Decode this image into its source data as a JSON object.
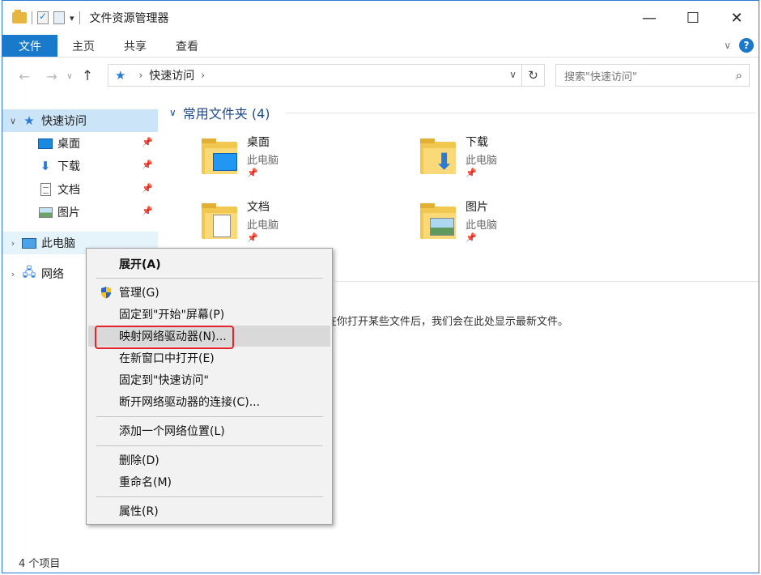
{
  "window": {
    "title": "文件资源管理器",
    "controls": {
      "minimize": "—",
      "maximize": "☐",
      "close": "✕"
    }
  },
  "ribbon": {
    "tabs": [
      "文件",
      "主页",
      "共享",
      "查看"
    ],
    "collapse": "∨",
    "help": "?"
  },
  "address": {
    "back": "←",
    "forward": "→",
    "recent": "∨",
    "up": "↑",
    "path": "快速访问",
    "refresh": "↻",
    "search_placeholder": "搜索\"快速访问\""
  },
  "nav": {
    "quick_access": "快速访问",
    "items": [
      {
        "label": "桌面",
        "icon": "desktop-icon"
      },
      {
        "label": "下载",
        "icon": "download-icon"
      },
      {
        "label": "文档",
        "icon": "documents-icon"
      },
      {
        "label": "图片",
        "icon": "pictures-icon"
      }
    ],
    "this_pc": "此电脑",
    "network": "网络"
  },
  "content": {
    "group_header": "常用文件夹 (4)",
    "folders": [
      {
        "name": "桌面",
        "location": "此电脑"
      },
      {
        "name": "下载",
        "location": "此电脑"
      },
      {
        "name": "文档",
        "location": "此电脑"
      },
      {
        "name": "图片",
        "location": "此电脑"
      }
    ],
    "recent_message": "在你打开某些文件后，我们会在此处显示最新文件。"
  },
  "status": {
    "item_count": "4 个项目"
  },
  "context_menu": {
    "items": {
      "expand": "展开(A)",
      "manage": "管理(G)",
      "pin_start": "固定到\"开始\"屏幕(P)",
      "map_drive": "映射网络驱动器(N)...",
      "open_new_window": "在新窗口中打开(E)",
      "pin_quick": "固定到\"快速访问\"",
      "disconnect_drive": "断开网络驱动器的连接(C)...",
      "add_network_location": "添加一个网络位置(L)",
      "delete": "删除(D)",
      "rename": "重命名(M)",
      "properties": "属性(R)"
    }
  },
  "colors": {
    "accent": "#1979ca",
    "selection": "#cce4f7",
    "highlight_box": "#e3242b"
  }
}
